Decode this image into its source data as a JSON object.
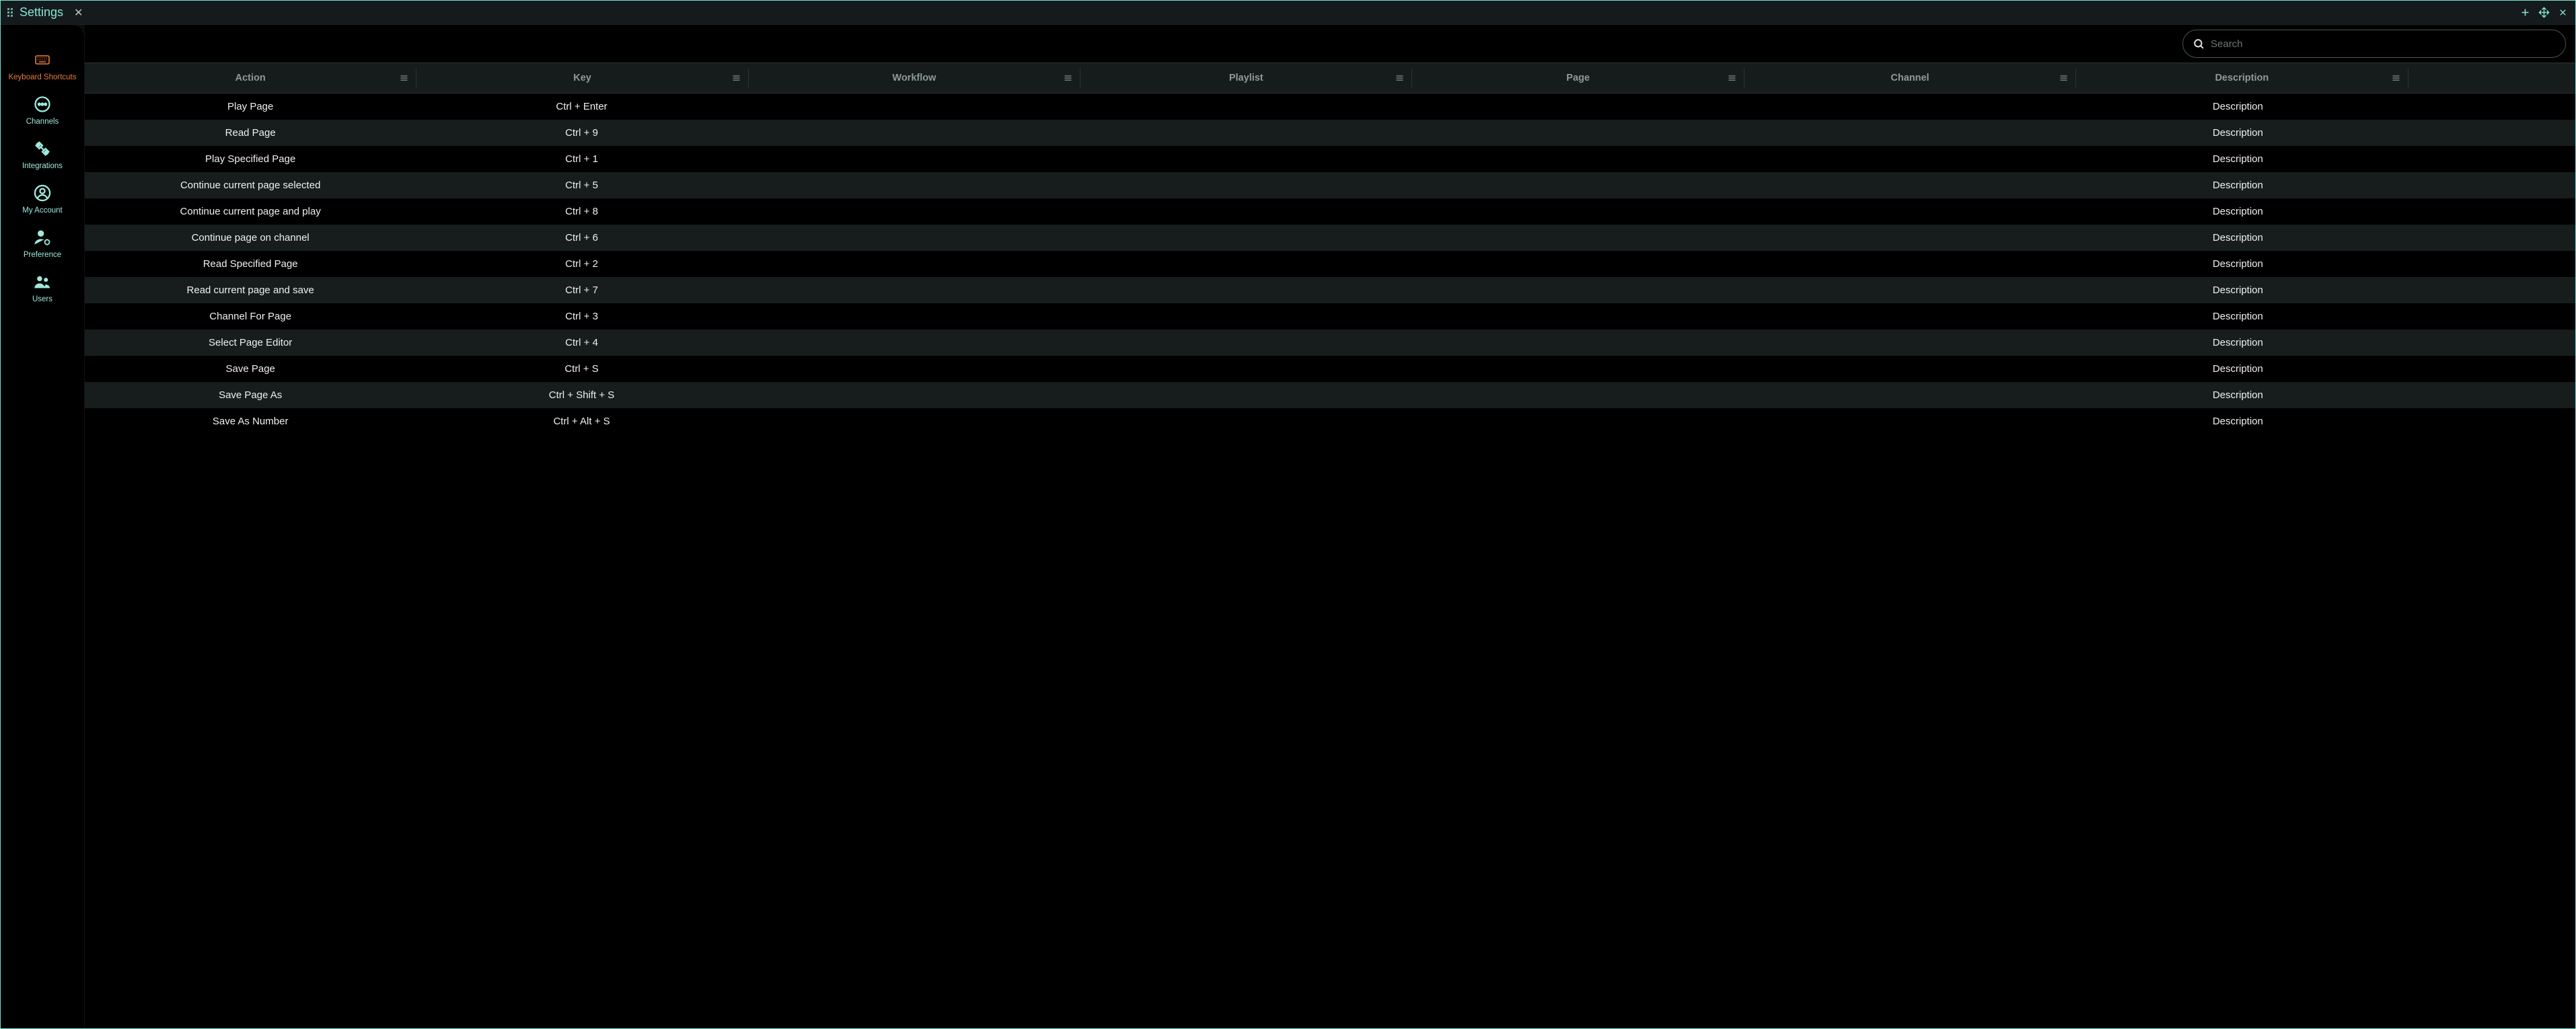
{
  "titlebar": {
    "title": "Settings"
  },
  "sidebar": {
    "items": [
      {
        "id": "keyboard-shortcuts",
        "label": "Keyboard Shortcuts",
        "icon": "keyboard-icon",
        "active": true
      },
      {
        "id": "channels",
        "label": "Channels",
        "icon": "more-circle-icon",
        "active": false
      },
      {
        "id": "integrations",
        "label": "Integrations",
        "icon": "plug-icon",
        "active": false
      },
      {
        "id": "my-account",
        "label": "My Account",
        "icon": "account-circle-icon",
        "active": false
      },
      {
        "id": "preference",
        "label": "Preference",
        "icon": "person-gear-icon",
        "active": false
      },
      {
        "id": "users",
        "label": "Users",
        "icon": "people-icon",
        "active": false
      }
    ]
  },
  "search": {
    "placeholder": "Search",
    "value": ""
  },
  "columns": [
    {
      "id": "action",
      "label": "Action"
    },
    {
      "id": "key",
      "label": "Key"
    },
    {
      "id": "workflow",
      "label": "Workflow"
    },
    {
      "id": "playlist",
      "label": "Playlist"
    },
    {
      "id": "page",
      "label": "Page"
    },
    {
      "id": "channel",
      "label": "Channel"
    },
    {
      "id": "description",
      "label": "Description"
    }
  ],
  "rows": [
    {
      "action": "Play Page",
      "key": "Ctrl + Enter",
      "workflow": "",
      "playlist": "",
      "page": "",
      "channel": "",
      "description": "Description"
    },
    {
      "action": "Read Page",
      "key": "Ctrl + 9",
      "workflow": "",
      "playlist": "",
      "page": "",
      "channel": "",
      "description": "Description"
    },
    {
      "action": "Play Specified Page",
      "key": "Ctrl + 1",
      "workflow": "",
      "playlist": "",
      "page": "",
      "channel": "",
      "description": "Description"
    },
    {
      "action": "Continue current page selected",
      "key": "Ctrl + 5",
      "workflow": "",
      "playlist": "",
      "page": "",
      "channel": "",
      "description": "Description"
    },
    {
      "action": "Continue current page and play",
      "key": "Ctrl + 8",
      "workflow": "",
      "playlist": "",
      "page": "",
      "channel": "",
      "description": "Description"
    },
    {
      "action": "Continue page on channel",
      "key": "Ctrl + 6",
      "workflow": "",
      "playlist": "",
      "page": "",
      "channel": "",
      "description": "Description"
    },
    {
      "action": "Read Specified Page",
      "key": "Ctrl + 2",
      "workflow": "",
      "playlist": "",
      "page": "",
      "channel": "",
      "description": "Description"
    },
    {
      "action": "Read current page and save",
      "key": "Ctrl + 7",
      "workflow": "",
      "playlist": "",
      "page": "",
      "channel": "",
      "description": "Description"
    },
    {
      "action": "Channel For Page",
      "key": "Ctrl + 3",
      "workflow": "",
      "playlist": "",
      "page": "",
      "channel": "",
      "description": "Description"
    },
    {
      "action": "Select Page Editor",
      "key": "Ctrl + 4",
      "workflow": "",
      "playlist": "",
      "page": "",
      "channel": "",
      "description": "Description"
    },
    {
      "action": "Save Page",
      "key": "Ctrl + S",
      "workflow": "",
      "playlist": "",
      "page": "",
      "channel": "",
      "description": "Description"
    },
    {
      "action": "Save Page As",
      "key": "Ctrl + Shift + S",
      "workflow": "",
      "playlist": "",
      "page": "",
      "channel": "",
      "description": "Description"
    },
    {
      "action": "Save As Number",
      "key": "Ctrl + Alt + S",
      "workflow": "",
      "playlist": "",
      "page": "",
      "channel": "",
      "description": "Description"
    }
  ]
}
